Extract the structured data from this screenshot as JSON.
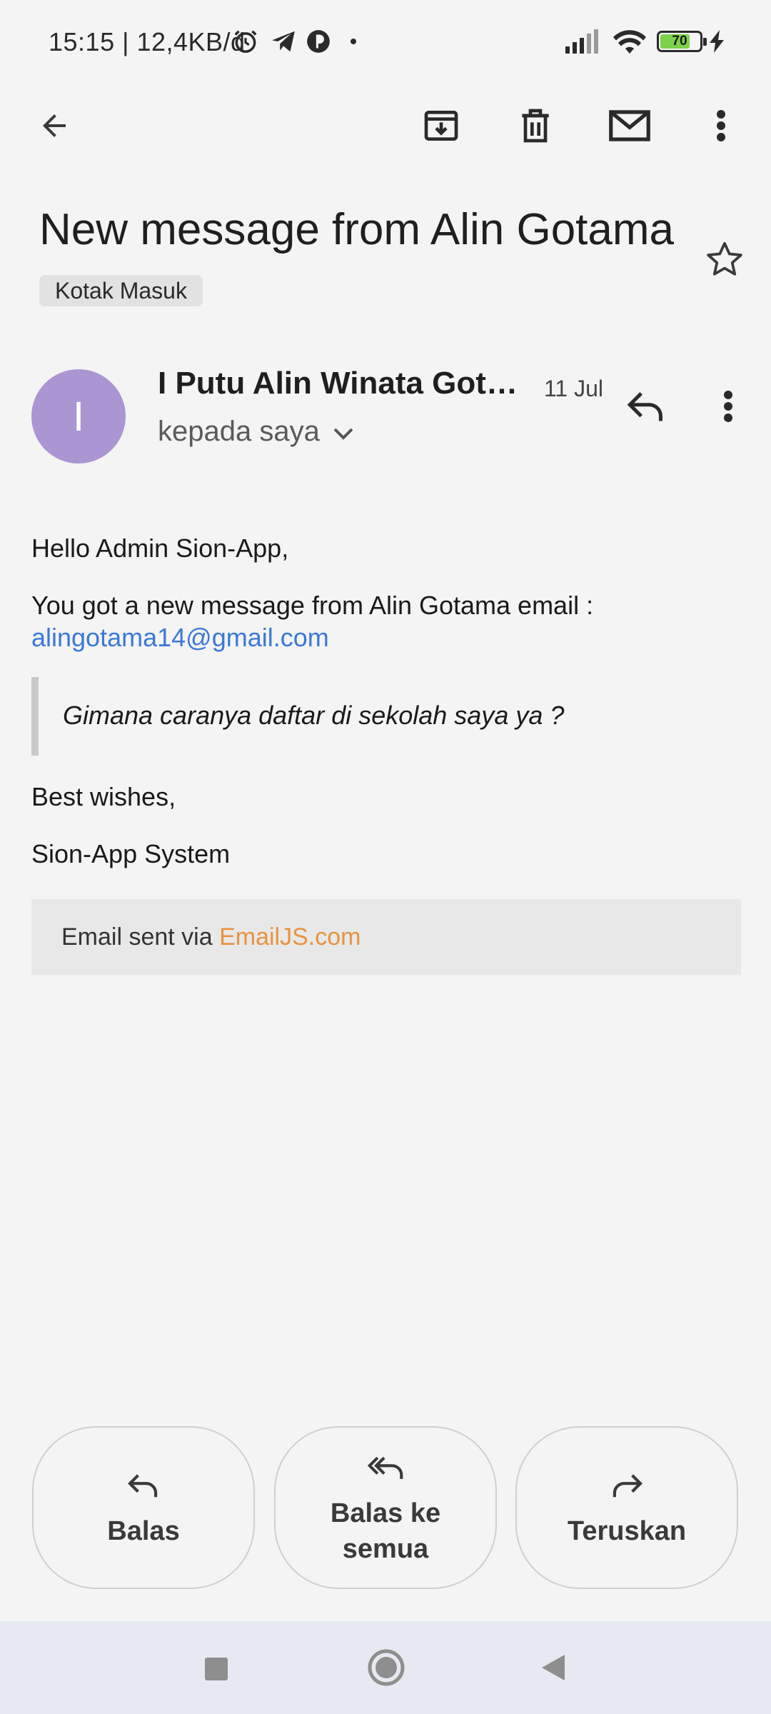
{
  "status_bar": {
    "time": "15:15 | 12,4KB/d",
    "battery_level": "70",
    "icons": [
      "alarm-icon",
      "telegram-icon",
      "app-icon",
      "dot-icon",
      "signal-icon",
      "wifi-icon",
      "battery-icon",
      "charging-icon"
    ]
  },
  "toolbar": {
    "icons": [
      "back-arrow-icon",
      "archive-icon",
      "delete-icon",
      "mark-unread-icon",
      "more-vert-icon"
    ]
  },
  "email": {
    "subject": "New message from Alin Gotama",
    "label": "Kotak Masuk",
    "sender": {
      "avatar_letter": "I",
      "avatar_color": "#ab95d3",
      "name": "I Putu Alin Winata Gota...",
      "date": "11 Jul",
      "recipient": "kepada saya"
    },
    "body": {
      "greeting": "Hello Admin Sion-App,",
      "intro": "You got a new message from Alin Gotama email :",
      "email_link": "alingotama14@gmail.com",
      "quote": "Gimana caranya daftar di sekolah saya ya ?",
      "closing": "Best wishes,",
      "signature": "Sion-App System"
    },
    "footer": {
      "prefix": "Email sent via ",
      "link": "EmailJS.com",
      "link_color": "#e8933f"
    }
  },
  "actions": {
    "reply": "Balas",
    "reply_all_line1": "Balas ke",
    "reply_all_line2": "semua",
    "forward": "Teruskan"
  },
  "nav": {
    "icons": [
      "recents-square-icon",
      "home-circle-icon",
      "back-triangle-icon"
    ]
  },
  "colors": {
    "link": "#3b78d8",
    "background": "#f4f4f4",
    "battery_fill": "#7cd34a"
  }
}
